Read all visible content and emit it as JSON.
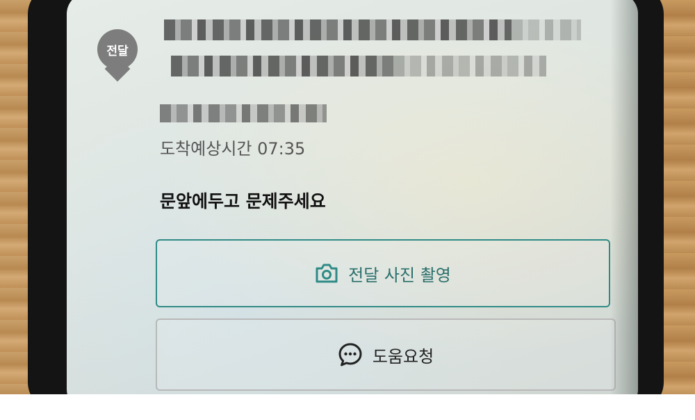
{
  "delivery": {
    "status_badge": "전달",
    "eta_text": "도착예상시간 07:35",
    "request_text": "문앞에두고 문제주세요"
  },
  "buttons": {
    "photo_label": "전달 사진 촬영",
    "help_label": "도움요청"
  },
  "icons": {
    "photo": "camera-icon",
    "help": "chat-bubble-icon"
  },
  "colors": {
    "accent": "#2f8a85",
    "badge": "#7d7d7d"
  }
}
